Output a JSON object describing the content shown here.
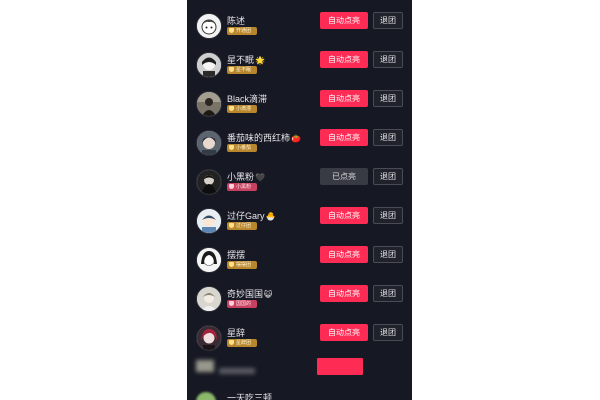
{
  "buttons": {
    "auto_label": "自动点亮",
    "lit_label": "已点亮",
    "leave_label": "退团"
  },
  "colors": {
    "background": "#161823",
    "accent": "#fe2c55",
    "lit_button": "#393b44",
    "gold_badge": "#b8862c",
    "pink_badge": "#c7405f"
  },
  "members": [
    {
      "name": "陈述",
      "emoji": "",
      "badge": "开通团",
      "badge_color": "gold",
      "status": "auto",
      "avatar_icon": "avatar-cartoon-boy-icon"
    },
    {
      "name": "星不眠",
      "emoji": "🌟",
      "badge": "星不眠",
      "badge_color": "gold",
      "status": "auto",
      "avatar_icon": "avatar-dark-cartoon-icon"
    },
    {
      "name": "Black滴滞",
      "emoji": "",
      "badge": "小滴滞",
      "badge_color": "gold",
      "status": "auto",
      "avatar_icon": "avatar-dark-figure-icon"
    },
    {
      "name": "番茄味的西红柿",
      "emoji": "🍅",
      "badge": "小番茄",
      "badge_color": "gold",
      "status": "auto",
      "avatar_icon": "avatar-anime-portrait-icon"
    },
    {
      "name": "小黑粉",
      "emoji": "🖤",
      "badge": "小黑粉",
      "badge_color": "pink",
      "status": "lit",
      "avatar_icon": "avatar-dark-hooded-icon"
    },
    {
      "name": "过仔Gary",
      "emoji": "🐣",
      "badge": "过仔团",
      "badge_color": "gold",
      "status": "auto",
      "avatar_icon": "avatar-blue-cartoon-icon"
    },
    {
      "name": "摆摆",
      "emoji": "",
      "badge": "摆摆团",
      "badge_color": "gold",
      "status": "auto",
      "avatar_icon": "avatar-anime-girl-icon"
    },
    {
      "name": "奇妙国国",
      "emoji": "😺",
      "badge": "国国的",
      "badge_color": "pink",
      "status": "auto",
      "avatar_icon": "avatar-light-portrait-icon"
    },
    {
      "name": "星辞",
      "emoji": "",
      "badge": "星辞团",
      "badge_color": "gold",
      "status": "auto",
      "avatar_icon": "avatar-red-hair-icon"
    }
  ],
  "partial_member": {
    "name": "一天吃三顿"
  }
}
